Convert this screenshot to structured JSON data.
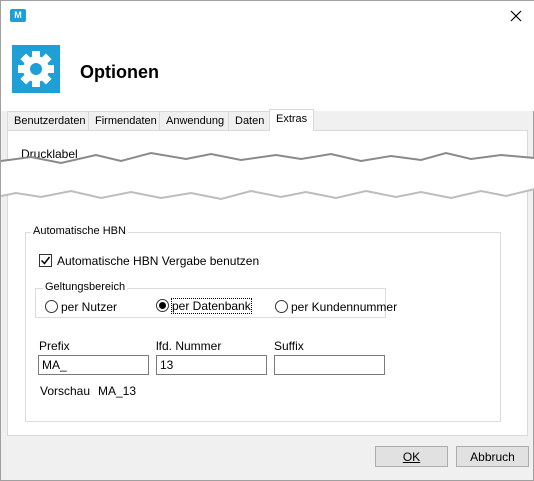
{
  "window": {
    "app_icon_text": "M",
    "title": "Optionen"
  },
  "tabs": [
    {
      "label": "Benutzerdaten",
      "active": false
    },
    {
      "label": "Firmendaten",
      "active": false
    },
    {
      "label": "Anwendung",
      "active": false
    },
    {
      "label": "Daten",
      "active": false
    },
    {
      "label": "Extras",
      "active": true
    }
  ],
  "partial_section": {
    "label": "Drucklabel"
  },
  "hbn": {
    "group_label": "Automatische HBN",
    "checkbox": {
      "label": "Automatische HBN Vergabe benutzen",
      "checked": true
    },
    "scope": {
      "label": "Geltungsbereich",
      "options": [
        {
          "label": "per Nutzer",
          "selected": false
        },
        {
          "label": "per Datenbank",
          "selected": true
        },
        {
          "label": "per Kundennummer",
          "selected": false
        }
      ]
    },
    "fields": {
      "prefix_label": "Prefix",
      "prefix_value": "MA_",
      "number_label": "lfd. Nummer",
      "number_value": "13",
      "suffix_label": "Suffix",
      "suffix_value": ""
    },
    "preview": {
      "label": "Vorschau",
      "value": "MA_13"
    }
  },
  "buttons": {
    "ok_label": "OK",
    "cancel_label": "Abbruch"
  },
  "colors": {
    "accent": "#1e9fd6"
  },
  "icons": [
    "app-icon",
    "close-icon",
    "gear-icon"
  ]
}
